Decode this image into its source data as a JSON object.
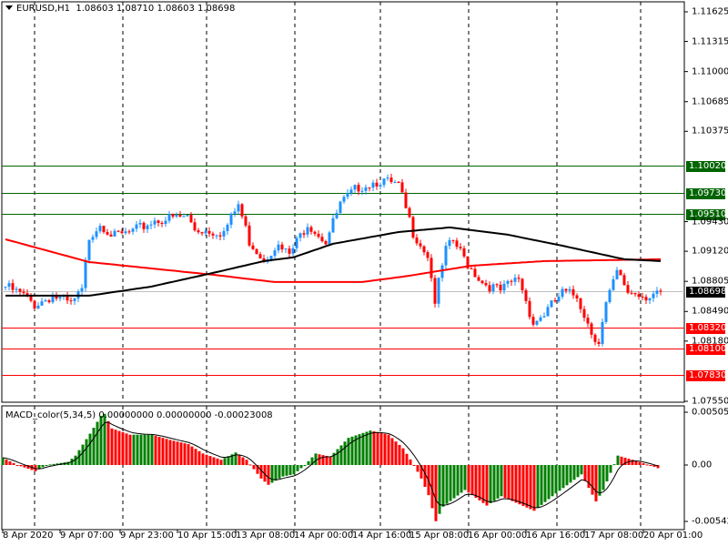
{
  "header": {
    "symbol": "EURUSD,H1",
    "open": "1.08603",
    "high": "1.08710",
    "low": "1.08603",
    "close": "1.08698"
  },
  "macd_label": "MACD_color(5,34,5) 0.00000000 0.00000000 -0.00023008",
  "colors": {
    "bull": "#1E90FF",
    "bear": "#FF0000",
    "support": "#FF0000",
    "resistance": "#006400",
    "ma_fast": "#000000",
    "ma_slow": "#FF0000",
    "macd_up": "#008000",
    "macd_down": "#FF0000",
    "current": "#000000"
  },
  "price_axis": [
    "1.11625",
    "1.11315",
    "1.11000",
    "1.10685",
    "1.10375",
    "1.09430",
    "1.09120",
    "1.08805",
    "1.08490",
    "1.08180",
    "1.07550"
  ],
  "price_range": [
    1.0755,
    1.11625
  ],
  "levels": [
    {
      "price": "1.10020",
      "type": "resistance"
    },
    {
      "price": "1.09730",
      "type": "resistance"
    },
    {
      "price": "1.09510",
      "type": "resistance"
    },
    {
      "price": "1.08320",
      "type": "support"
    },
    {
      "price": "1.08100",
      "type": "support"
    },
    {
      "price": "1.07830",
      "type": "support"
    }
  ],
  "current_price": "1.08698",
  "macd_axis": {
    "top": "0.0050517",
    "zero": "0.00",
    "bottom": "-0.005424"
  },
  "time_axis": [
    "8 Apr 2020",
    "9 Apr 07:00",
    "9 Apr 23:00",
    "10 Apr 15:00",
    "13 Apr 08:00",
    "14 Apr 00:00",
    "14 Apr 16:00",
    "15 Apr 08:00",
    "16 Apr 00:00",
    "16 Apr 16:00",
    "17 Apr 08:00",
    "20 Apr 01:00"
  ],
  "chart_data": {
    "type": "candlestick",
    "bars": 181,
    "close_keypoints": [
      [
        0,
        1.0875
      ],
      [
        5,
        1.08655
      ],
      [
        8,
        1.0856
      ],
      [
        13,
        1.08655
      ],
      [
        18,
        1.0856
      ],
      [
        21,
        1.08702
      ],
      [
        23,
        1.09274
      ],
      [
        26,
        1.09416
      ],
      [
        30,
        1.09274
      ],
      [
        35,
        1.09321
      ],
      [
        41,
        1.09445
      ],
      [
        50,
        1.09483
      ],
      [
        52,
        1.0935
      ],
      [
        60,
        1.09321
      ],
      [
        64,
        1.09607
      ],
      [
        67,
        1.09226
      ],
      [
        71,
        1.09036
      ],
      [
        74,
        1.09178
      ],
      [
        78,
        1.09083
      ],
      [
        83,
        1.09416
      ],
      [
        88,
        1.09226
      ],
      [
        92,
        1.09607
      ],
      [
        97,
        1.09797
      ],
      [
        103,
        1.09864
      ],
      [
        108,
        1.09797
      ],
      [
        112,
        1.09321
      ],
      [
        116,
        1.09083
      ],
      [
        118,
        1.08607
      ],
      [
        121,
        1.09131
      ],
      [
        123,
        1.09226
      ],
      [
        127,
        1.08988
      ],
      [
        131,
        1.08798
      ],
      [
        136,
        1.08702
      ],
      [
        141,
        1.08845
      ],
      [
        145,
        1.08369
      ],
      [
        148,
        1.08464
      ],
      [
        153,
        1.08683
      ],
      [
        157,
        1.08655
      ],
      [
        161,
        1.08274
      ],
      [
        163,
        1.08179
      ],
      [
        165,
        1.0856
      ],
      [
        168,
        1.08893
      ],
      [
        171,
        1.08702
      ],
      [
        176,
        1.08655
      ],
      [
        180,
        1.08698
      ]
    ],
    "ma_black_keypoints": [
      [
        0,
        1.08655
      ],
      [
        23,
        1.08655
      ],
      [
        40,
        1.0875
      ],
      [
        57,
        1.08893
      ],
      [
        71,
        1.09017
      ],
      [
        79,
        1.09055
      ],
      [
        90,
        1.09198
      ],
      [
        108,
        1.09321
      ],
      [
        122,
        1.09369
      ],
      [
        138,
        1.09293
      ],
      [
        153,
        1.09178
      ],
      [
        170,
        1.09036
      ],
      [
        180,
        1.09017
      ]
    ],
    "ma_red_keypoints": [
      [
        0,
        1.09245
      ],
      [
        23,
        1.09007
      ],
      [
        57,
        1.08874
      ],
      [
        74,
        1.08798
      ],
      [
        98,
        1.08798
      ],
      [
        111,
        1.08864
      ],
      [
        128,
        1.08969
      ],
      [
        148,
        1.09017
      ],
      [
        180,
        1.09036
      ]
    ],
    "macd_keypoints": [
      [
        0,
        0.0007
      ],
      [
        4,
        0
      ],
      [
        9,
        -0.0006
      ],
      [
        12,
        0
      ],
      [
        18,
        0.0003
      ],
      [
        20,
        0.0009
      ],
      [
        24,
        0.003
      ],
      [
        27,
        0.0047
      ],
      [
        28,
        0.0049
      ],
      [
        30,
        0.0035
      ],
      [
        35,
        0.0029
      ],
      [
        41,
        0.0029
      ],
      [
        46,
        0.0024
      ],
      [
        51,
        0.002
      ],
      [
        55,
        0.0011
      ],
      [
        60,
        0.0005
      ],
      [
        64,
        0.0012
      ],
      [
        67,
        0.0005
      ],
      [
        71,
        -0.0013
      ],
      [
        73,
        -0.0019
      ],
      [
        77,
        -0.0011
      ],
      [
        80,
        -0.0009
      ],
      [
        83,
        0
      ],
      [
        86,
        0.0011
      ],
      [
        90,
        0.0008
      ],
      [
        95,
        0.0026
      ],
      [
        101,
        0.0033
      ],
      [
        106,
        0.0029
      ],
      [
        110,
        0.0016
      ],
      [
        113,
        0
      ],
      [
        115,
        -0.0013
      ],
      [
        117,
        -0.0029
      ],
      [
        119,
        -0.0054
      ],
      [
        121,
        -0.004
      ],
      [
        127,
        -0.0024
      ],
      [
        133,
        -0.0039
      ],
      [
        137,
        -0.003
      ],
      [
        146,
        -0.0044
      ],
      [
        151,
        -0.003
      ],
      [
        159,
        -0.0009
      ],
      [
        163,
        -0.0035
      ],
      [
        165,
        -0.0024
      ],
      [
        169,
        0.0009
      ],
      [
        174,
        0.0004
      ],
      [
        180,
        -0.0003
      ]
    ],
    "macd_range": [
      -0.005424,
      0.0050517
    ]
  }
}
